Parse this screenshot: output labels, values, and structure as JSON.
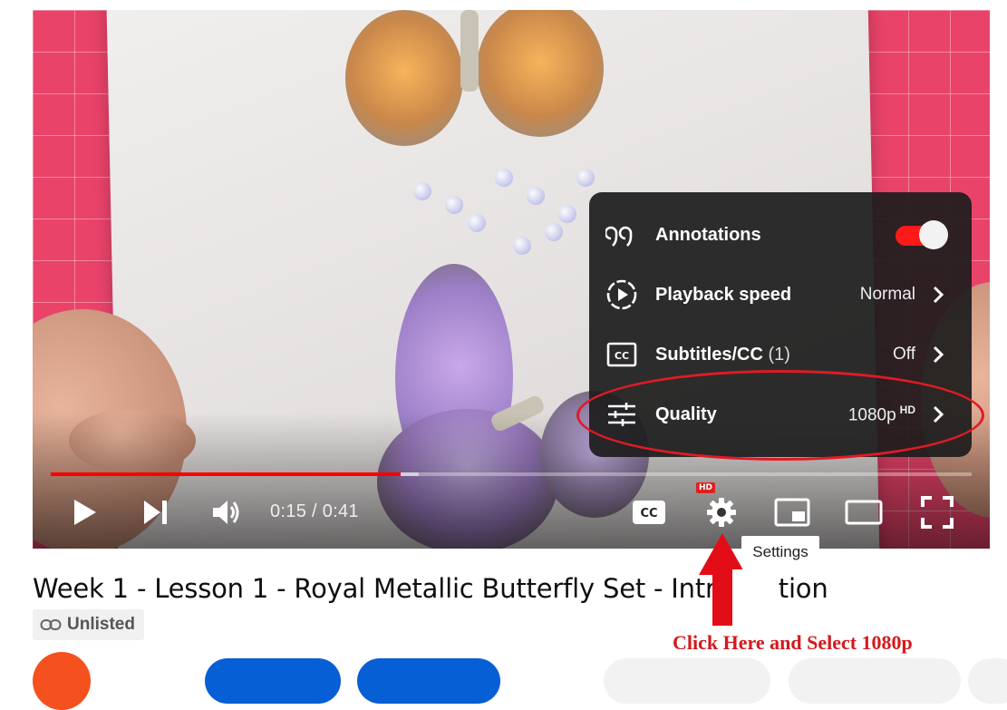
{
  "player": {
    "time_current": "0:15",
    "time_separator": " / ",
    "time_total": "0:41",
    "progress_played_fraction": 0.38,
    "progress_buffer_fraction": 0.4,
    "hd_badge": "HD",
    "tooltip": "Settings"
  },
  "settings_menu": {
    "items": [
      {
        "label": "Annotations",
        "icon": "annotations-icon",
        "toggle_on": true
      },
      {
        "label": "Playback speed",
        "icon": "playback-speed-icon",
        "value": "Normal"
      },
      {
        "label": "Subtitles/CC",
        "count": "(1)",
        "icon": "subtitles-icon",
        "value": "Off"
      },
      {
        "label": "Quality",
        "icon": "quality-icon",
        "value": "1080p",
        "value_sup": "HD"
      }
    ]
  },
  "annotation": {
    "instruction": "Click Here and Select 1080p",
    "color": "#d4191c"
  },
  "video": {
    "title": "Week 1 - Lesson 1 - Royal Metallic Butterfly Set - Introduction",
    "visibility": "Unlisted"
  },
  "colors": {
    "progress": "#ff0000",
    "toggle_on": "#ff1a1a",
    "menu_bg": "#1c1c1c"
  }
}
